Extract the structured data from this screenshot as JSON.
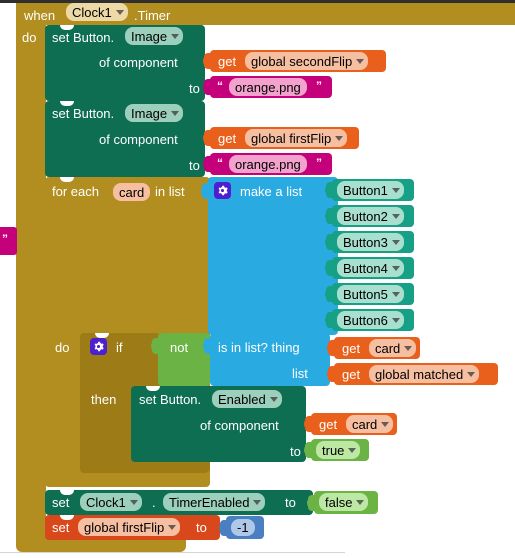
{
  "app": {
    "name": "MIT App Inventor Blocks Editor",
    "canvas_background": "#ffffff"
  },
  "colors": {
    "control": "#B18E1F",
    "component_setter": "#0E6E52",
    "component_getter": "#16A085",
    "variable": "#E8601C",
    "text": "#C4007A",
    "list": "#29ABE2",
    "logic": "#6AB344",
    "math": "#4A7FC1"
  },
  "program": {
    "event": {
      "when_label": "when",
      "component": "Clock1",
      "event_name": ".Timer",
      "do_label": "do"
    },
    "set_image_1": {
      "set_label": "set Button.",
      "property": "Image",
      "of_component_label": "of component",
      "to_label": "to",
      "component_value": {
        "get_label": "get",
        "variable": "global secondFlip"
      },
      "value": "orange.png",
      "open_quote": "“",
      "close_quote": "”"
    },
    "set_image_2": {
      "set_label": "set Button.",
      "property": "Image",
      "of_component_label": "of component",
      "to_label": "to",
      "component_value": {
        "get_label": "get",
        "variable": "global firstFlip"
      },
      "value": "orange.png",
      "open_quote": "“",
      "close_quote": "”"
    },
    "foreach": {
      "for_each_label": "for each",
      "loop_variable": "card",
      "in_list_label": "in list",
      "do_label": "do",
      "make_a_list_label": "make a list",
      "list_items": [
        "Button1",
        "Button2",
        "Button3",
        "Button4",
        "Button5",
        "Button6"
      ]
    },
    "if_block": {
      "if_label": "if",
      "then_label": "then",
      "not_label": "not",
      "is_in_list_label": "is in list? thing",
      "list_label": "list",
      "thing_value": {
        "get_label": "get",
        "variable": "card"
      },
      "list_value": {
        "get_label": "get",
        "variable": "global matched"
      },
      "then_statement": {
        "set_label": "set Button.",
        "property": "Enabled",
        "of_component_label": "of component",
        "to_label": "to",
        "component_value": {
          "get_label": "get",
          "variable": "card"
        },
        "value": "true"
      }
    },
    "set_timer_enabled": {
      "set_label": "set",
      "component": "Clock1",
      "dot": ".",
      "property": "TimerEnabled",
      "to_label": "to",
      "value": "false"
    },
    "set_first_flip": {
      "set_label": "set",
      "variable": "global firstFlip",
      "to_label": "to",
      "value": "-1"
    },
    "orphan_text_fragment": {
      "close_quote": "”"
    }
  }
}
